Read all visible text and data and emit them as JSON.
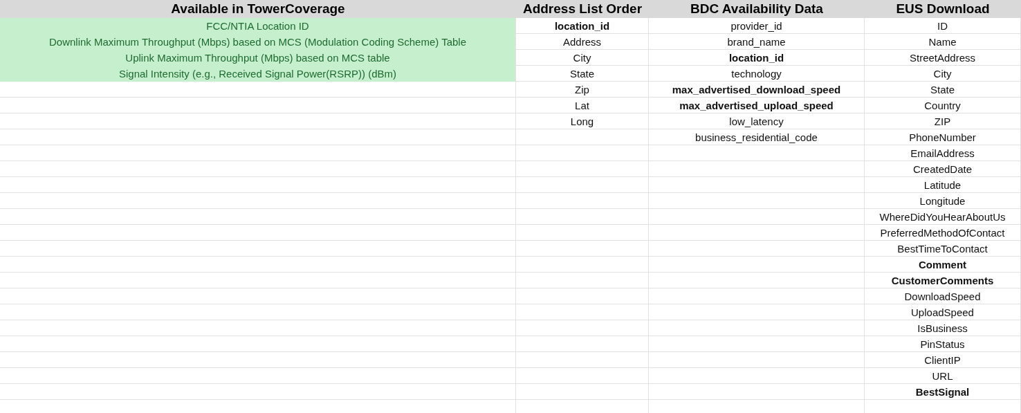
{
  "columns": [
    {
      "header": "Available in TowerCoverage",
      "cells": [
        {
          "text": "FCC/NTIA Location ID",
          "bold": false,
          "highlighted": true
        },
        {
          "text": "Downlink Maximum Throughput (Mbps) based on MCS (Modulation Coding Scheme) Table",
          "bold": false,
          "highlighted": true
        },
        {
          "text": "Uplink Maximum Throughput (Mbps) based on MCS table",
          "bold": false,
          "highlighted": true
        },
        {
          "text": "Signal Intensity (e.g., Received Signal Power(RSRP)) (dBm)",
          "bold": false,
          "highlighted": true
        }
      ]
    },
    {
      "header": "Address List Order",
      "cells": [
        {
          "text": "location_id",
          "bold": true,
          "highlighted": false
        },
        {
          "text": "Address",
          "bold": false,
          "highlighted": false
        },
        {
          "text": "City",
          "bold": false,
          "highlighted": false
        },
        {
          "text": "State",
          "bold": false,
          "highlighted": false
        },
        {
          "text": "Zip",
          "bold": false,
          "highlighted": false
        },
        {
          "text": "Lat",
          "bold": false,
          "highlighted": false
        },
        {
          "text": "Long",
          "bold": false,
          "highlighted": false
        }
      ]
    },
    {
      "header": "BDC Availability Data",
      "cells": [
        {
          "text": "provider_id",
          "bold": false,
          "highlighted": false
        },
        {
          "text": "brand_name",
          "bold": false,
          "highlighted": false
        },
        {
          "text": "location_id",
          "bold": true,
          "highlighted": false
        },
        {
          "text": "technology",
          "bold": false,
          "highlighted": false
        },
        {
          "text": "max_advertised_download_speed",
          "bold": true,
          "highlighted": false
        },
        {
          "text": "max_advertised_upload_speed",
          "bold": true,
          "highlighted": false
        },
        {
          "text": "low_latency",
          "bold": false,
          "highlighted": false
        },
        {
          "text": "business_residential_code",
          "bold": false,
          "highlighted": false
        }
      ]
    },
    {
      "header": "EUS Download",
      "cells": [
        {
          "text": "ID",
          "bold": false,
          "highlighted": false
        },
        {
          "text": "Name",
          "bold": false,
          "highlighted": false
        },
        {
          "text": "StreetAddress",
          "bold": false,
          "highlighted": false
        },
        {
          "text": "City",
          "bold": false,
          "highlighted": false
        },
        {
          "text": "State",
          "bold": false,
          "highlighted": false
        },
        {
          "text": "Country",
          "bold": false,
          "highlighted": false
        },
        {
          "text": "ZIP",
          "bold": false,
          "highlighted": false
        },
        {
          "text": "PhoneNumber",
          "bold": false,
          "highlighted": false
        },
        {
          "text": "EmailAddress",
          "bold": false,
          "highlighted": false
        },
        {
          "text": "CreatedDate",
          "bold": false,
          "highlighted": false
        },
        {
          "text": "Latitude",
          "bold": false,
          "highlighted": false
        },
        {
          "text": "Longitude",
          "bold": false,
          "highlighted": false
        },
        {
          "text": "WhereDidYouHearAboutUs",
          "bold": false,
          "highlighted": false
        },
        {
          "text": "PreferredMethodOfContact",
          "bold": false,
          "highlighted": false
        },
        {
          "text": "BestTimeToContact",
          "bold": false,
          "highlighted": false
        },
        {
          "text": "Comment",
          "bold": true,
          "highlighted": false
        },
        {
          "text": "CustomerComments",
          "bold": true,
          "highlighted": false
        },
        {
          "text": "DownloadSpeed",
          "bold": false,
          "highlighted": false
        },
        {
          "text": "UploadSpeed",
          "bold": false,
          "highlighted": false
        },
        {
          "text": "IsBusiness",
          "bold": false,
          "highlighted": false
        },
        {
          "text": "PinStatus",
          "bold": false,
          "highlighted": false
        },
        {
          "text": "ClientIP",
          "bold": false,
          "highlighted": false
        },
        {
          "text": "URL",
          "bold": false,
          "highlighted": false
        },
        {
          "text": "BestSignal",
          "bold": true,
          "highlighted": false
        }
      ]
    }
  ]
}
